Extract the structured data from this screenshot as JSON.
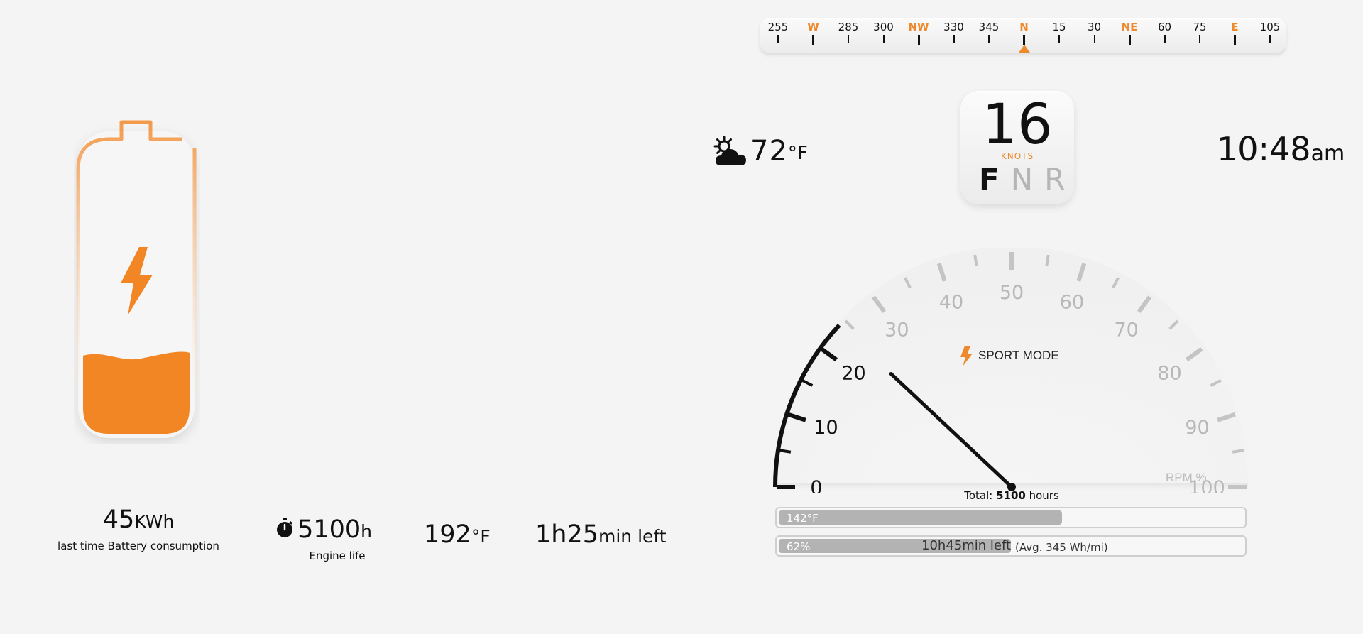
{
  "compass": {
    "labels": [
      "255",
      "W",
      "285",
      "300",
      "NW",
      "330",
      "345",
      "N",
      "15",
      "30",
      "NE",
      "60",
      "75",
      "E",
      "105"
    ],
    "cardinals": [
      "W",
      "NW",
      "N",
      "NE",
      "E"
    ],
    "heading_label": "N",
    "accent": "#ee8a2e"
  },
  "battery": {
    "level_fraction": 0.27,
    "icon": "lightning-bolt-icon",
    "color": "#f28624"
  },
  "weather": {
    "icon": "partly-cloudy-icon",
    "temperature": "72",
    "unit": "°F"
  },
  "speed": {
    "value": "16",
    "unit": "KNOTS",
    "gears": [
      "F",
      "N",
      "R"
    ],
    "active_gear": "F"
  },
  "clock": {
    "time": "10:48",
    "ampm": "am"
  },
  "gauge": {
    "labels": [
      "0",
      "10",
      "20",
      "30",
      "40",
      "50",
      "60",
      "70",
      "80",
      "90",
      "100"
    ],
    "unit_label": "RPM %",
    "mode_label": "SPORT MODE",
    "mode_icon": "lightning-bolt-icon",
    "value": 24,
    "active_color": "#111111",
    "inactive_color": "#b8b8b8"
  },
  "energy": {
    "value": "45",
    "unit": "KWh",
    "caption": "last time Battery consumption"
  },
  "engine": {
    "icon": "stopwatch-icon",
    "value": "5100",
    "unit": "h",
    "caption": "Engine life"
  },
  "coolant": {
    "value": "192",
    "unit": "°F"
  },
  "range": {
    "value": "1h25",
    "unit": "min left"
  },
  "total": {
    "prefix": "Total:",
    "value": "5100",
    "suffix": "hours"
  },
  "bars": {
    "temp": {
      "label": "142°F",
      "fraction": 0.61
    },
    "battery": {
      "label": "62%",
      "fraction": 0.5,
      "time": "10h45min left",
      "avg": "(Avg. 345 Wh/mi)"
    }
  }
}
